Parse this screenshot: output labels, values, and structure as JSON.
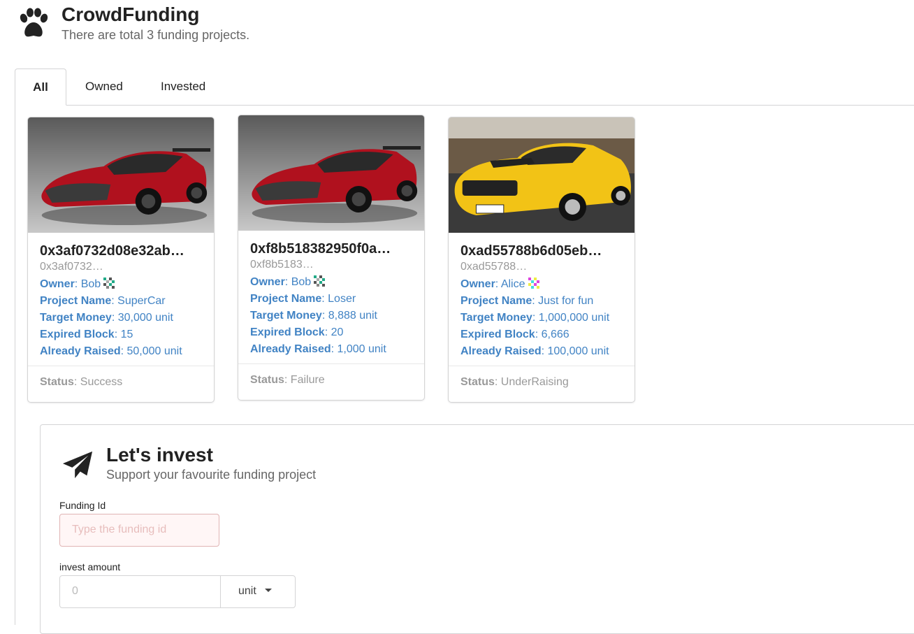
{
  "app": {
    "title": "CrowdFunding",
    "subtitle": "There are total 3 funding projects."
  },
  "tabs": [
    {
      "label": "All",
      "active": true
    },
    {
      "label": "Owned",
      "active": false
    },
    {
      "label": "Invested",
      "active": false
    }
  ],
  "labels": {
    "owner": "Owner",
    "project_name": "Project Name",
    "target_money": "Target Money",
    "expired_block": "Expired Block",
    "already_raised": "Already Raised",
    "status": "Status"
  },
  "projects": [
    {
      "address": "0x3af0732d08e32ab…",
      "address_short": "0x3af0732…",
      "owner": "Bob",
      "project_name": "SuperCar",
      "target_money": "30,000 unit",
      "expired_block": "15",
      "already_raised": "50,000 unit",
      "status": "Success",
      "image": "red-sports-car"
    },
    {
      "address": "0xf8b518382950f0a…",
      "address_short": "0xf8b5183…",
      "owner": "Bob",
      "project_name": "Loser",
      "target_money": "8,888 unit",
      "expired_block": "20",
      "already_raised": "1,000 unit",
      "status": "Failure",
      "image": "red-sports-car"
    },
    {
      "address": "0xad55788b6d05eb…",
      "address_short": "0xad55788…",
      "owner": "Alice",
      "project_name": "Just for fun",
      "target_money": "1,000,000 unit",
      "expired_block": "6,666",
      "already_raised": "100,000 unit",
      "status": "UnderRaising",
      "image": "yellow-muscle-car"
    }
  ],
  "invest": {
    "title": "Let's invest",
    "subtitle": "Support your favourite funding project",
    "funding_id_label": "Funding Id",
    "funding_id_placeholder": "Type the funding id",
    "amount_label": "invest amount",
    "amount_placeholder": "0",
    "unit_selected": "unit"
  },
  "colors": {
    "link_blue": "#4183c4",
    "error_bg": "#fff6f6",
    "border": "#d4d4d5"
  }
}
